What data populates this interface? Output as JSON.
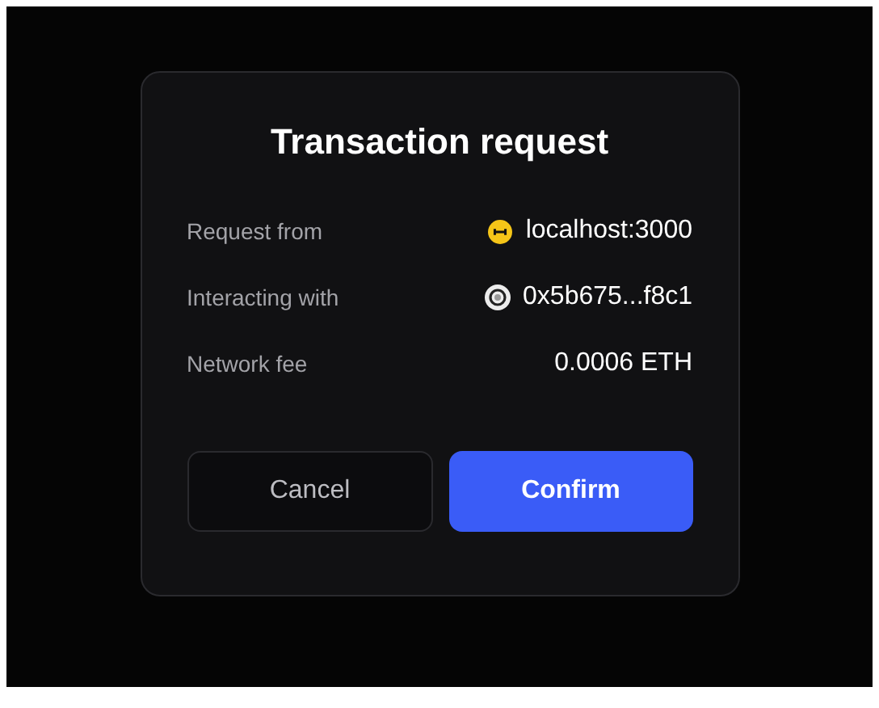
{
  "dialog": {
    "title": "Transaction request",
    "rows": [
      {
        "label": "Request from",
        "value": "localhost:3000",
        "kind": "site"
      },
      {
        "label": "Interacting with",
        "value": "0x5b675...f8c1",
        "kind": "contract"
      },
      {
        "label": "Network fee",
        "value": "0.0006 ETH",
        "kind": "plain"
      }
    ],
    "buttons": [
      {
        "label": "Cancel",
        "kind": "secondary"
      },
      {
        "label": "Confirm",
        "kind": "primary"
      }
    ]
  }
}
